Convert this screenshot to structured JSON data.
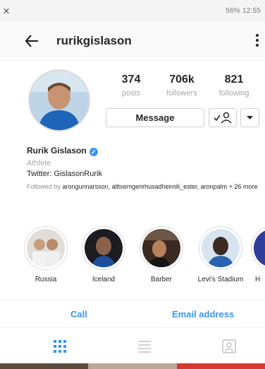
{
  "status_bar": {
    "close_glyph": "×",
    "right_text": "56% 12:55"
  },
  "header": {
    "username": "rurikgislason",
    "back_icon": "arrow-left-icon",
    "more_icon": "more-vertical-icon"
  },
  "stats": [
    {
      "value": "374",
      "label": "posts"
    },
    {
      "value": "706k",
      "label": "followers"
    },
    {
      "value": "821",
      "label": "following"
    }
  ],
  "actions": {
    "message_label": "Message",
    "follow_icon": "person-check-icon",
    "dropdown_icon": "caret-down-icon"
  },
  "bio": {
    "name": "Rurik Gislason",
    "verified_mark": "✓",
    "category": "Athlete",
    "text": "Twitter: GislasonRurik",
    "followed_prefix": "Followed by ",
    "followed_names": "arongunnarsson, alltsemgerirhusadheimili_ester, aronpalm",
    "followed_suffix": " + 26 more"
  },
  "highlights": [
    {
      "label": "Russia"
    },
    {
      "label": "Iceland"
    },
    {
      "label": "Barber"
    },
    {
      "label": "Levi's Stadium"
    },
    {
      "label": "H"
    }
  ],
  "contact": {
    "call_label": "Call",
    "email_label": "Email address"
  },
  "tabs": [
    {
      "icon": "grid-icon",
      "active": true
    },
    {
      "icon": "list-icon",
      "active": false
    },
    {
      "icon": "tagged-icon",
      "active": false
    }
  ],
  "colors": {
    "link": "#3897f0",
    "verified": "#3897f0",
    "muted": "#a6a6a6",
    "text": "#262626"
  }
}
